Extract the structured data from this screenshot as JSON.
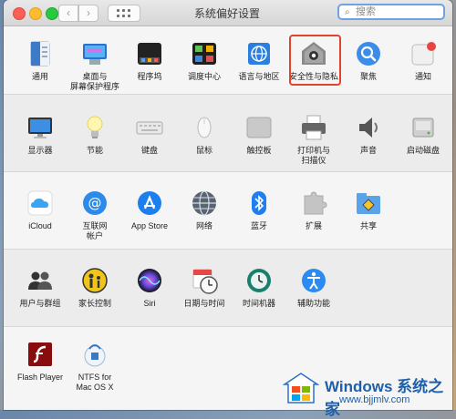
{
  "window": {
    "title": "系统偏好设置"
  },
  "search": {
    "placeholder": "搜索",
    "value": ""
  },
  "accent": "#6fa2e2",
  "highlight_color": "#e0442c",
  "sections": [
    {
      "items": [
        {
          "label": "通用",
          "icon": "general-icon"
        },
        {
          "label": "桌面与\n屏幕保护程序",
          "icon": "desktop-icon"
        },
        {
          "label": "程序坞",
          "icon": "dock-icon"
        },
        {
          "label": "调度中心",
          "icon": "mission-control-icon"
        },
        {
          "label": "语言与地区",
          "icon": "language-icon"
        },
        {
          "label": "安全性与隐私",
          "icon": "security-icon",
          "selected": true
        },
        {
          "label": "聚焦",
          "icon": "spotlight-icon"
        },
        {
          "label": "通知",
          "icon": "notifications-icon"
        }
      ]
    },
    {
      "items": [
        {
          "label": "显示器",
          "icon": "display-icon"
        },
        {
          "label": "节能",
          "icon": "energy-icon"
        },
        {
          "label": "键盘",
          "icon": "keyboard-icon"
        },
        {
          "label": "鼠标",
          "icon": "mouse-icon"
        },
        {
          "label": "触控板",
          "icon": "trackpad-icon"
        },
        {
          "label": "打印机与\n扫描仪",
          "icon": "printer-icon"
        },
        {
          "label": "声音",
          "icon": "sound-icon"
        },
        {
          "label": "启动磁盘",
          "icon": "startup-disk-icon"
        }
      ]
    },
    {
      "items": [
        {
          "label": "iCloud",
          "icon": "icloud-icon"
        },
        {
          "label": "互联网\n帐户",
          "icon": "internet-accounts-icon"
        },
        {
          "label": "App Store",
          "icon": "app-store-icon"
        },
        {
          "label": "网络",
          "icon": "network-icon"
        },
        {
          "label": "蓝牙",
          "icon": "bluetooth-icon"
        },
        {
          "label": "扩展",
          "icon": "extensions-icon"
        },
        {
          "label": "共享",
          "icon": "sharing-icon"
        }
      ]
    },
    {
      "items": [
        {
          "label": "用户与群组",
          "icon": "users-icon"
        },
        {
          "label": "家长控制",
          "icon": "parental-controls-icon"
        },
        {
          "label": "Siri",
          "icon": "siri-icon"
        },
        {
          "label": "日期与时间",
          "icon": "date-time-icon"
        },
        {
          "label": "时间机器",
          "icon": "time-machine-icon"
        },
        {
          "label": "辅助功能",
          "icon": "accessibility-icon"
        }
      ]
    },
    {
      "items": [
        {
          "label": "Flash Player",
          "icon": "flash-icon"
        },
        {
          "label": "NTFS for\nMac OS X",
          "icon": "ntfs-icon"
        }
      ]
    }
  ],
  "watermark": {
    "title": "Windows 系统之家",
    "url": "www.bjjmlv.com"
  }
}
